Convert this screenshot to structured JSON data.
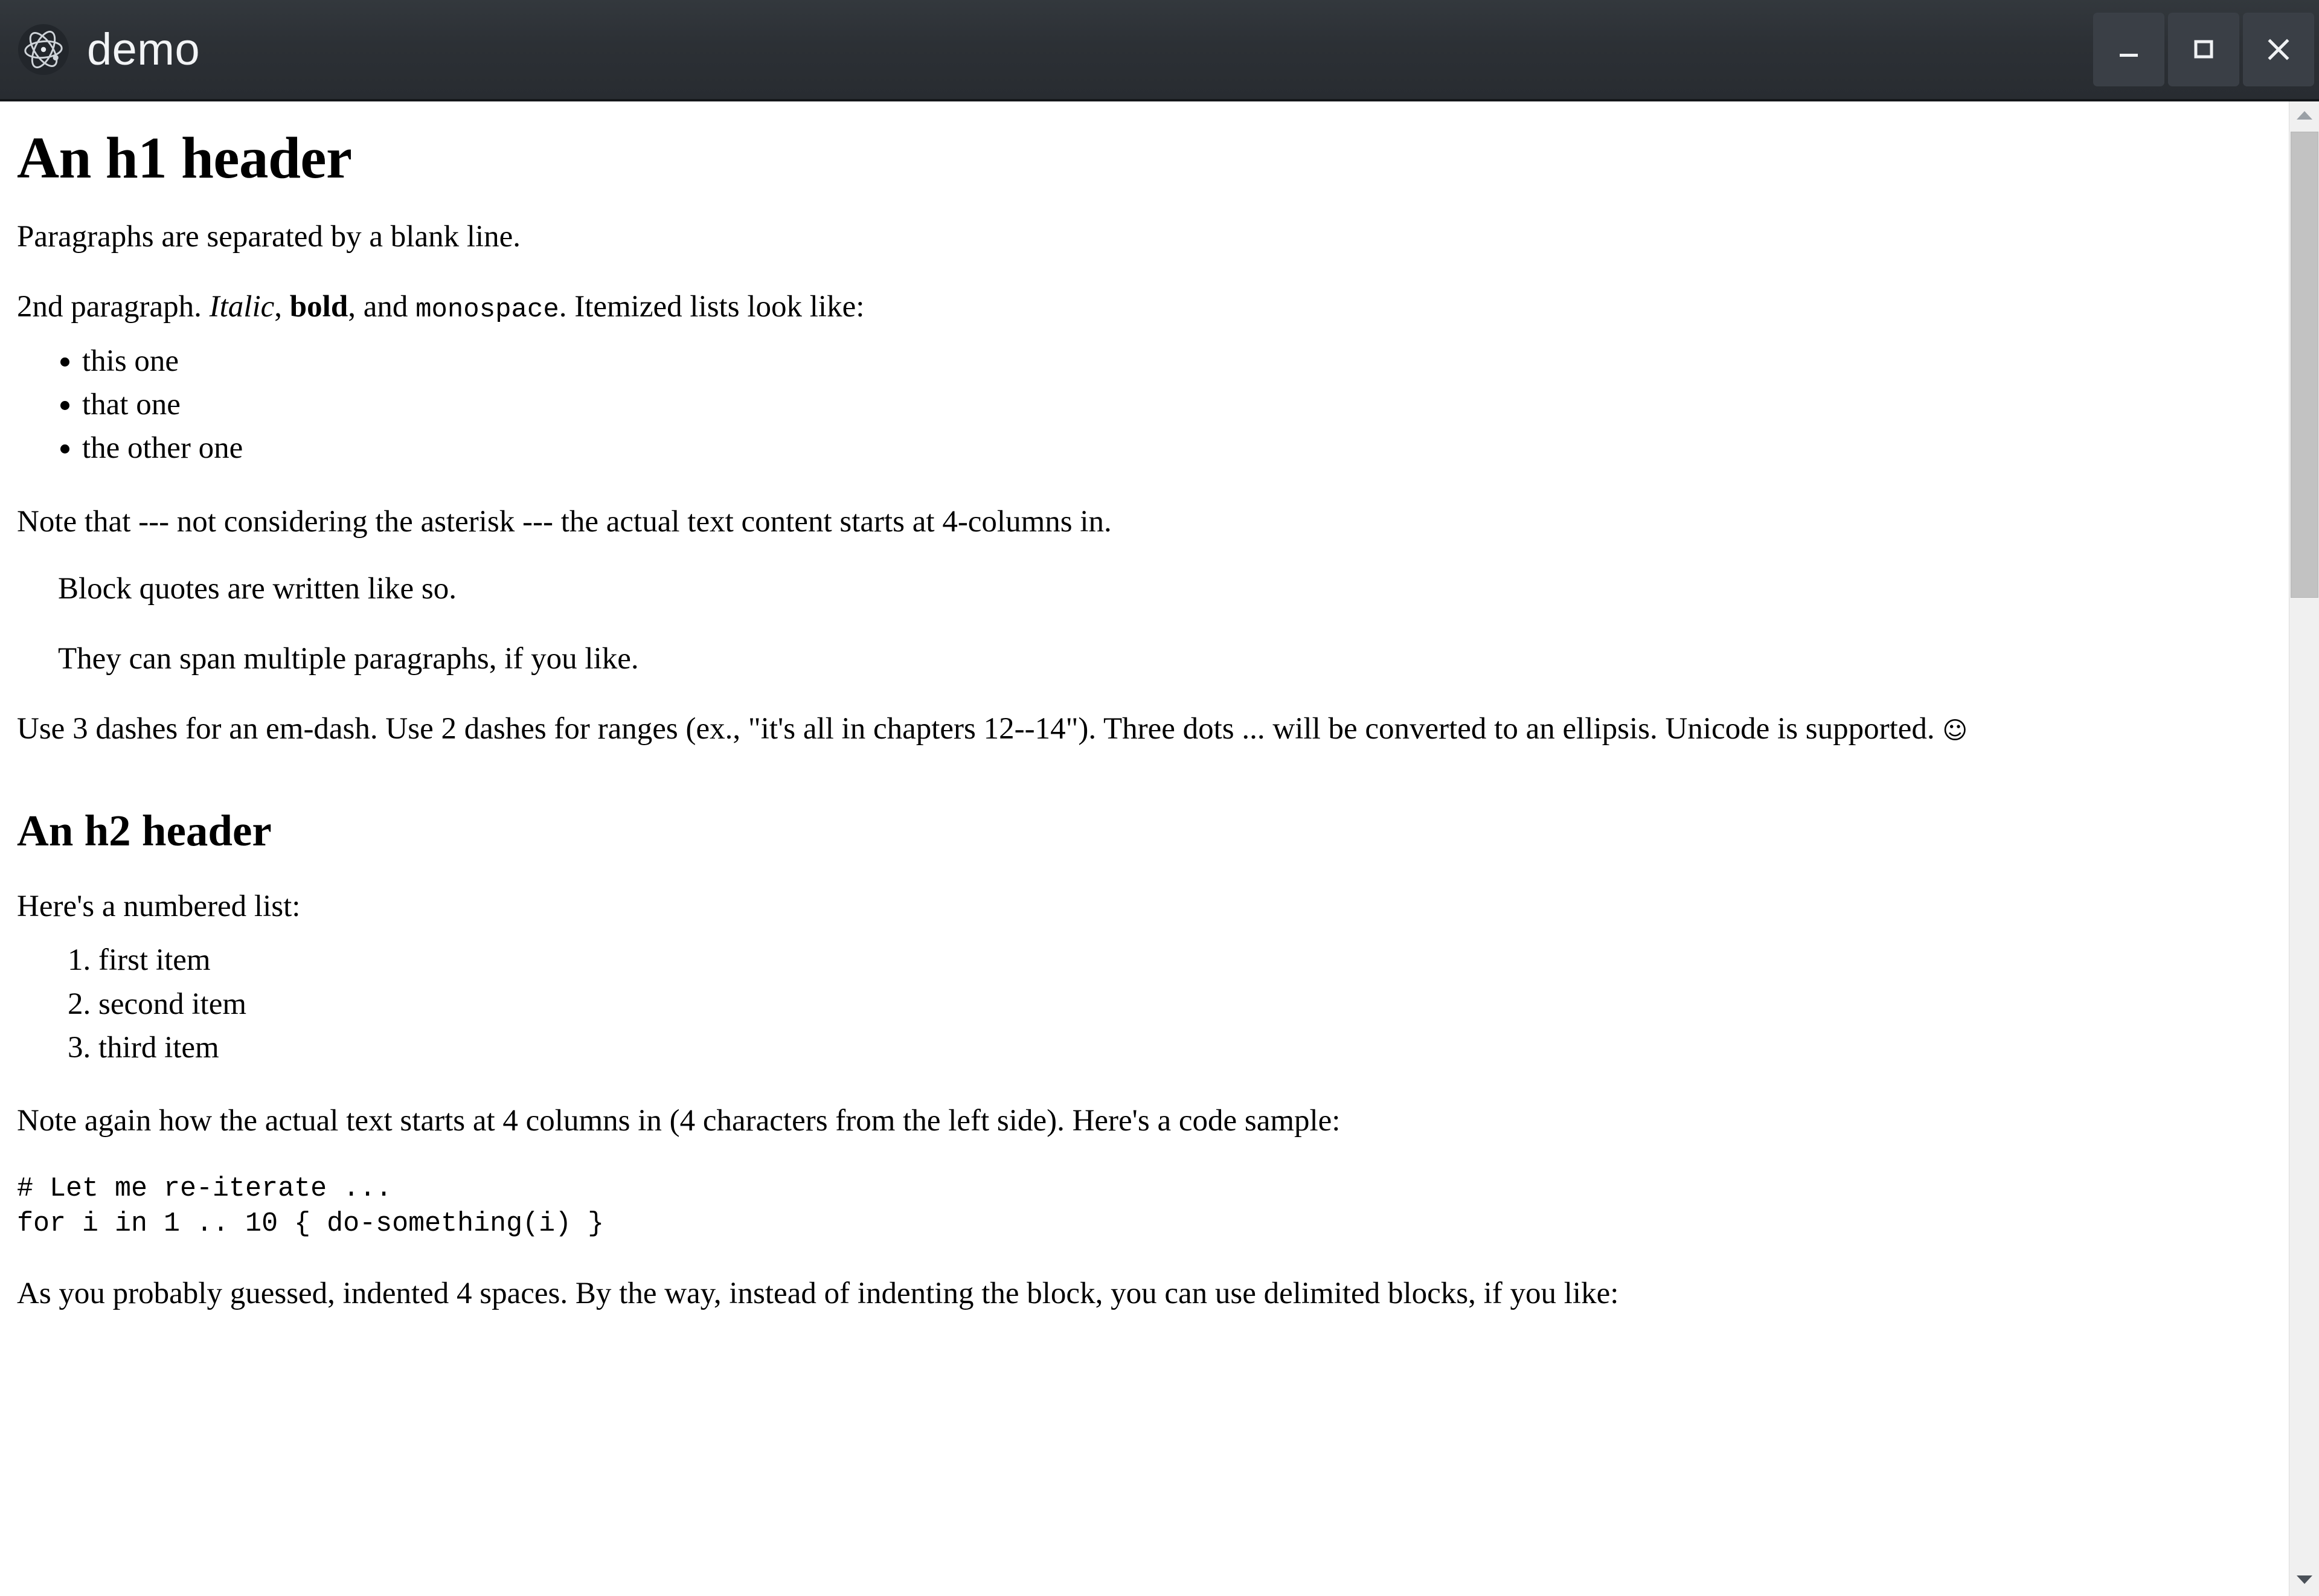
{
  "window": {
    "title": "demo",
    "icon": "atom-icon",
    "titlebar_bg": "#2c3035",
    "controls": {
      "minimize_label": "Minimize",
      "maximize_label": "Maximize",
      "close_label": "Close"
    }
  },
  "document": {
    "h1": "An h1 header",
    "para1": "Paragraphs are separated by a blank line.",
    "para2": {
      "lead": "2nd paragraph. ",
      "italic": "Italic",
      "mid1": ", ",
      "bold": "bold",
      "mid2": ", and ",
      "code": "monospace",
      "tail": ". Itemized lists look like:"
    },
    "bullets": [
      "this one",
      "that one",
      "the other one"
    ],
    "para3": "Note that --- not considering the asterisk --- the actual text content starts at 4-columns in.",
    "blockquote": [
      "Block quotes are written like so.",
      "They can span multiple paragraphs, if you like."
    ],
    "para4": {
      "text": "Use 3 dashes for an em-dash. Use 2 dashes for ranges (ex., \"it's all in chapters 12--14\"). Three dots ... will be converted to an ellipsis. Unicode is supported. ",
      "emoji": "☺"
    },
    "h2": "An h2 header",
    "para5": "Here's a numbered list:",
    "numbered": [
      "first item",
      "second item",
      "third item"
    ],
    "para6": "Note again how the actual text starts at 4 columns in (4 characters from the left side). Here's a code sample:",
    "code_block": "# Let me re-iterate ...\nfor i in 1 .. 10 { do-something(i) }",
    "para7": "As you probably guessed, indented 4 spaces. By the way, instead of indenting the block, you can use delimited blocks, if you like:"
  },
  "scrollbar": {
    "up_arrow": "chevron-up-icon",
    "down_arrow": "chevron-down-icon",
    "thumb_label": "scrollbar-thumb"
  }
}
